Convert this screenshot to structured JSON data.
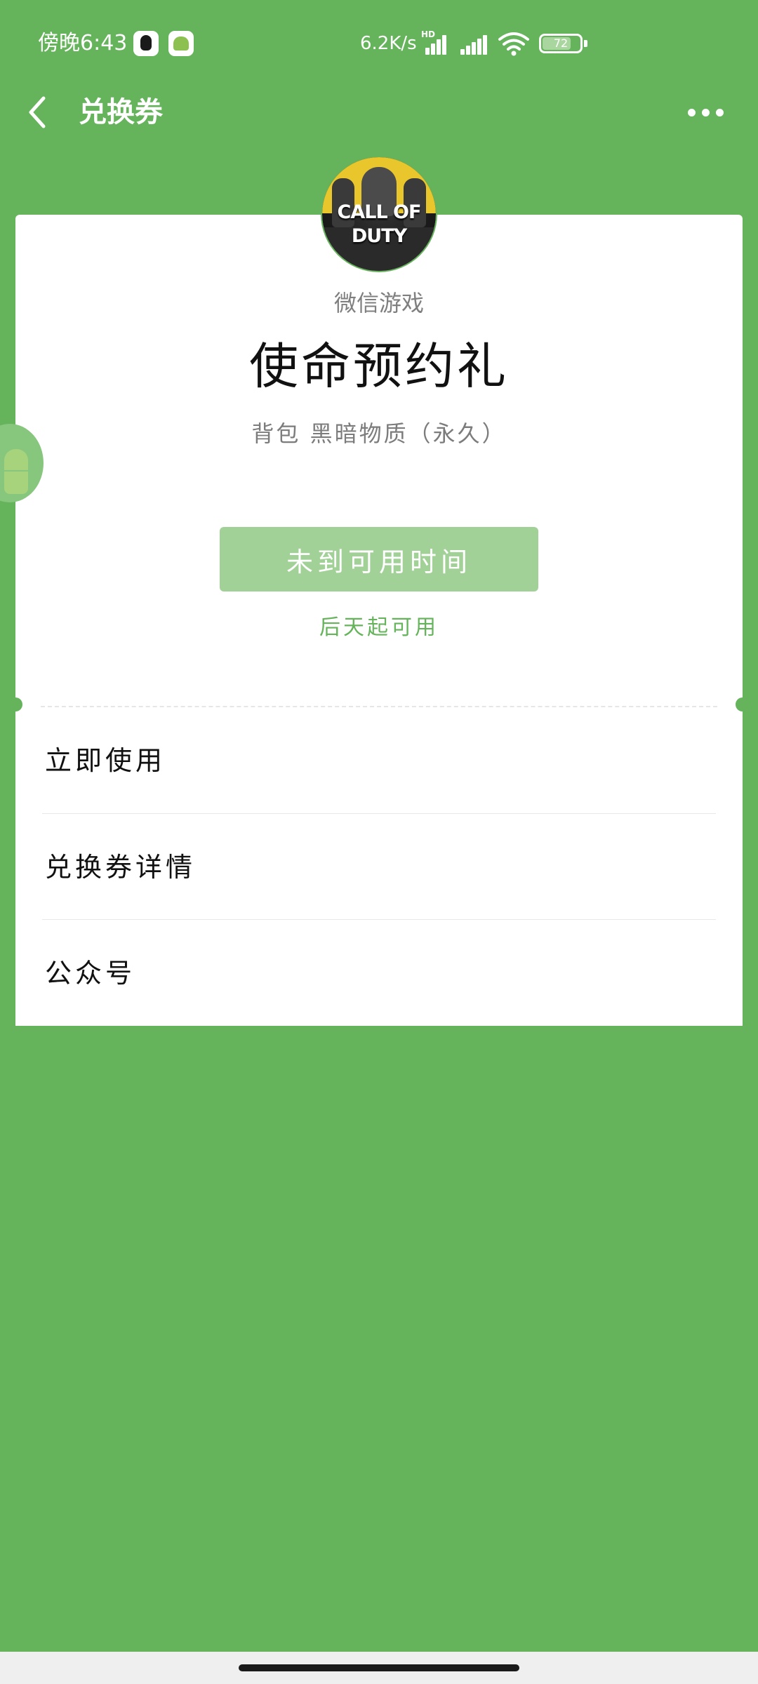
{
  "status_bar": {
    "time": "傍晚6:43",
    "net_speed": "6.2K/s",
    "hd": "HD",
    "battery": "72"
  },
  "header": {
    "title": "兑换券"
  },
  "coupon": {
    "provider": "微信游戏",
    "title": "使命预约礼",
    "subtitle": "背包 黑暗物质（永久）",
    "button_label": "未到可用时间",
    "availability_note": "后天起可用",
    "avatar_logo": "CALL OF DUTY"
  },
  "menu": {
    "items": [
      {
        "label": "立即使用"
      },
      {
        "label": "兑换券详情"
      },
      {
        "label": "公众号"
      }
    ]
  },
  "colors": {
    "background": "#65b35b",
    "button_disabled": "#a2d198",
    "accent_text": "#65b35b"
  },
  "icons": {
    "back": "chevron-left-icon",
    "more": "more-horizontal-icon",
    "wifi": "wifi-icon",
    "battery": "battery-icon"
  }
}
